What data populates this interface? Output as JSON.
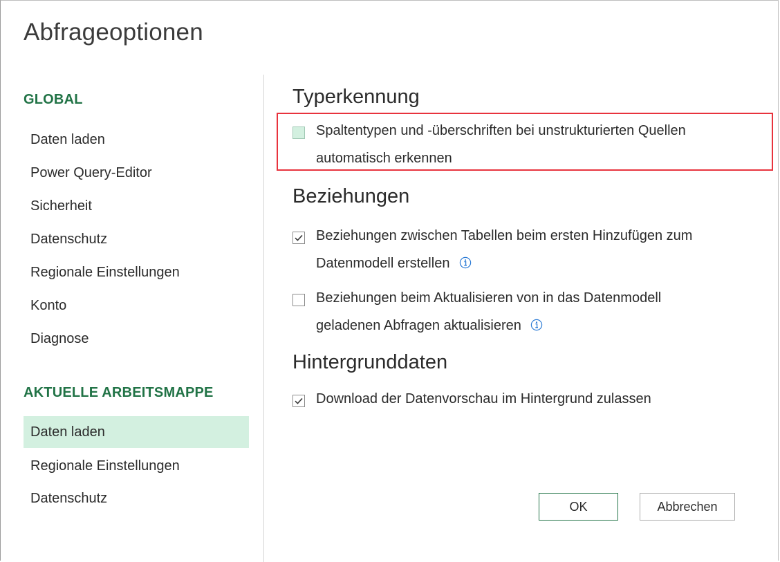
{
  "dialog": {
    "title": "Abfrageoptionen"
  },
  "sidebar": {
    "global_heading": "GLOBAL",
    "global_items": [
      {
        "label": "Daten laden"
      },
      {
        "label": "Power Query-Editor"
      },
      {
        "label": "Sicherheit"
      },
      {
        "label": "Datenschutz"
      },
      {
        "label": "Regionale Einstellungen"
      },
      {
        "label": "Konto"
      },
      {
        "label": "Diagnose"
      }
    ],
    "workbook_heading": "AKTUELLE ARBEITSMAPPE",
    "workbook_items": [
      {
        "label": "Daten laden",
        "selected": true
      },
      {
        "label": "Regionale Einstellungen",
        "selected": false
      },
      {
        "label": "Datenschutz",
        "selected": false
      }
    ]
  },
  "content": {
    "type_detection": {
      "heading": "Typerkennung",
      "option_line1": "Spaltentypen und -überschriften bei unstrukturierten Quellen",
      "option_line2": "automatisch erkennen",
      "checked": false
    },
    "relationships": {
      "heading": "Beziehungen",
      "option1_line1": "Beziehungen zwischen Tabellen beim ersten Hinzufügen zum",
      "option1_line2": "Datenmodell erstellen",
      "option1_checked": true,
      "option2_line1": "Beziehungen beim Aktualisieren von in das Datenmodell",
      "option2_line2": "geladenen Abfragen aktualisieren",
      "option2_checked": false
    },
    "background_data": {
      "heading": "Hintergrunddaten",
      "option": "Download der Datenvorschau im Hintergrund zulassen",
      "checked": true
    }
  },
  "buttons": {
    "ok": "OK",
    "cancel": "Abbrechen"
  },
  "colors": {
    "accent": "#217346",
    "selected_bg": "#d3f0e0",
    "highlight_border": "#e8333d",
    "info_icon": "#2a7ad5"
  },
  "icons": {
    "check": "checkmark-icon",
    "info": "info-icon"
  }
}
